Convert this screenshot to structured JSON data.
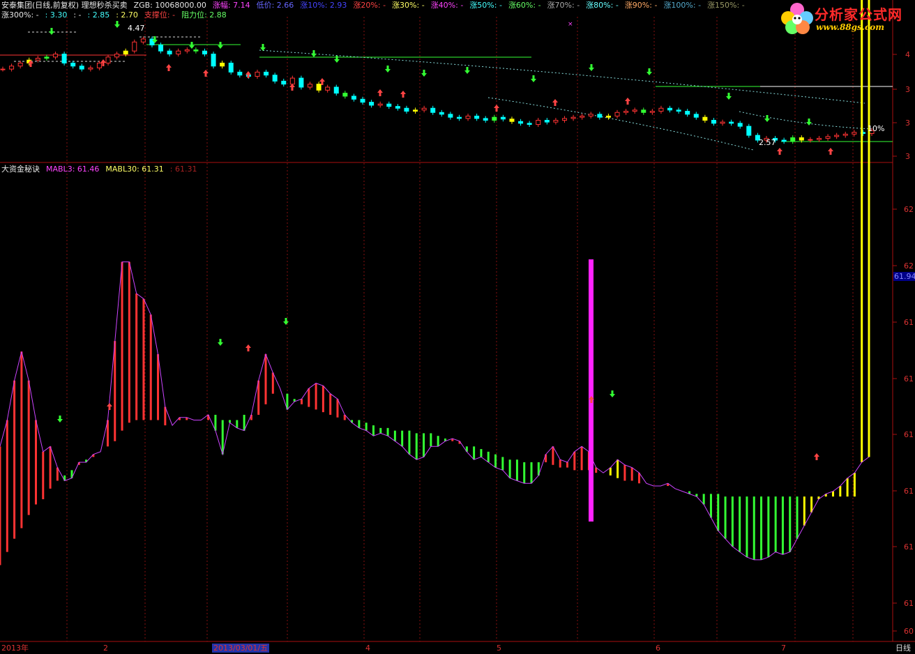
{
  "header": {
    "row1": [
      {
        "text": "安泰集团(日线,前复权) 理想秒杀买卖",
        "color": "#e8e8e8"
      },
      {
        "text": "ZGB: 10068000.00",
        "color": "#e8e8e8"
      },
      {
        "text": "涨幅: 7.14",
        "color": "#ff44ff"
      },
      {
        "text": "低价: 2.66",
        "color": "#6666ff"
      },
      {
        "text": "涨10%: 2.93",
        "color": "#4444ff"
      },
      {
        "text": "涨20%: -",
        "color": "#ff4444"
      },
      {
        "text": "涨30%: -",
        "color": "#ffff66"
      },
      {
        "text": "涨40%: -",
        "color": "#ff44ff"
      },
      {
        "text": "涨50%: -",
        "color": "#44ffff"
      },
      {
        "text": "涨60%: -",
        "color": "#66ff66"
      },
      {
        "text": "涨70%: -",
        "color": "#aaaaaa"
      },
      {
        "text": "涨80%: -",
        "color": "#66ffff"
      },
      {
        "text": "涨90%: -",
        "color": "#ffaa66"
      },
      {
        "text": "涨100%: -",
        "color": "#55aacc"
      },
      {
        "text": "涨150%: -",
        "color": "#999966"
      }
    ],
    "row2": [
      {
        "text": "涨300%: -",
        "color": "#e8e8e8"
      },
      {
        "text": ": 3.30",
        "color": "#44ffff"
      },
      {
        "text": ": -",
        "color": "#e8e8e8"
      },
      {
        "text": ": 2.85",
        "color": "#44ffff"
      },
      {
        "text": ": 2.70",
        "color": "#ffff66"
      },
      {
        "text": "支撑位: -",
        "color": "#ff4444"
      },
      {
        "text": "阻力位: 2.88",
        "color": "#66ff66"
      }
    ],
    "lower_title": [
      {
        "text": "大资金秘诀",
        "color": "#e8e8e8"
      },
      {
        "text": "MABL3: 61.46",
        "color": "#ff44ff"
      },
      {
        "text": "MABL30: 61.31",
        "color": "#ffff66"
      },
      {
        "text": ": 61.31",
        "color": "#aa2222"
      }
    ]
  },
  "logo": {
    "title": "分析家公式网",
    "url": "www.88gs.com"
  },
  "annotations": {
    "high_label": "4.47",
    "low_label": "2.57",
    "pct_label": "10%",
    "price_tag": "61.94"
  },
  "axes": {
    "upper_right_ticks": [
      "4",
      "3",
      "3",
      "3"
    ],
    "lower_right_ticks": [
      "62",
      "62",
      "61",
      "61",
      "61",
      "61",
      "61",
      "61",
      "60"
    ],
    "x_labels": [
      "2013年",
      "2",
      "2013/03/01/五",
      "4",
      "5",
      "6",
      "7"
    ],
    "period": "日线"
  },
  "colors": {
    "up": "#ff3333",
    "down": "#00ffff",
    "flat_yellow": "#ffff00",
    "green": "#33ff33",
    "magenta": "#ff22ff",
    "grid": "#881111"
  },
  "chart_data": [
    {
      "type": "candlestick",
      "title": "安泰集团(日线,前复权) 理想秒杀买卖",
      "y_range": [
        2.4,
        4.6
      ],
      "note_values": {
        "high": 4.47,
        "low": 2.57
      },
      "close": [
        3.8,
        3.85,
        3.9,
        3.95,
        3.98,
        4.0,
        4.05,
        3.9,
        3.85,
        3.8,
        3.82,
        3.9,
        4.0,
        4.05,
        4.1,
        4.25,
        4.3,
        4.2,
        4.1,
        4.05,
        4.1,
        4.12,
        4.1,
        4.05,
        3.85,
        3.9,
        3.75,
        3.7,
        3.68,
        3.75,
        3.7,
        3.6,
        3.55,
        3.65,
        3.5,
        3.55,
        3.45,
        3.5,
        3.4,
        3.35,
        3.3,
        3.25,
        3.2,
        3.22,
        3.18,
        3.15,
        3.1,
        3.12,
        3.15,
        3.08,
        3.05,
        3.0,
        2.98,
        3.02,
        2.98,
        2.95,
        3.0,
        2.97,
        2.93,
        2.9,
        2.88,
        2.95,
        2.92,
        2.95,
        2.98,
        3.0,
        3.02,
        3.05,
        3.0,
        3.02,
        3.08,
        3.1,
        3.12,
        3.08,
        3.1,
        3.15,
        3.12,
        3.1,
        3.05,
        3.0,
        2.95,
        2.9,
        2.92,
        2.9,
        2.85,
        2.7,
        2.62,
        2.65,
        2.62,
        2.6,
        2.66,
        2.62,
        2.63,
        2.65,
        2.68,
        2.7,
        2.72,
        2.75,
        2.73,
        2.78
      ]
    },
    {
      "type": "bar",
      "title": "大资金秘诀",
      "series": [
        {
          "name": "MABL3",
          "values": [
            61.46
          ]
        },
        {
          "name": "MABL30",
          "values": [
            61.31
          ]
        }
      ],
      "y_range": [
        60.8,
        62.4
      ],
      "tick_labels": [
        "62",
        "62",
        "61",
        "61",
        "61",
        "61",
        "61",
        "61",
        "60"
      ],
      "mabl3": [
        61.5,
        61.6,
        61.75,
        61.86,
        61.75,
        61.6,
        61.48,
        61.5,
        61.42,
        61.37,
        61.38,
        61.44,
        61.44,
        61.47,
        61.48,
        61.6,
        61.9,
        62.2,
        62.2,
        62.08,
        62.06,
        62.0,
        61.85,
        61.65,
        61.58,
        61.61,
        61.61,
        61.6,
        61.6,
        61.62,
        61.56,
        61.47,
        61.59,
        61.57,
        61.56,
        61.62,
        61.75,
        61.85,
        61.78,
        61.72,
        61.64,
        61.67,
        61.68,
        61.72,
        61.74,
        61.73,
        61.7,
        61.68,
        61.62,
        61.59,
        61.57,
        61.56,
        61.54,
        61.55,
        61.54,
        61.52,
        61.5,
        61.47,
        61.45,
        61.46,
        61.5,
        61.5,
        61.52,
        61.53,
        61.52,
        61.48,
        61.45,
        61.46,
        61.44,
        61.42,
        61.41,
        61.38,
        61.37,
        61.36,
        61.36,
        61.39,
        61.47,
        61.5,
        61.45,
        61.44,
        61.48,
        61.5,
        61.48,
        61.42,
        61.4,
        61.42,
        61.45,
        61.43,
        61.42,
        61.4,
        61.36,
        61.35,
        61.35,
        61.36,
        61.34,
        61.33,
        61.32,
        61.31,
        61.28,
        61.23,
        61.18,
        61.15,
        61.12,
        61.1,
        61.08,
        61.07,
        61.07,
        61.08,
        61.1,
        61.09,
        61.1,
        61.15,
        61.2,
        61.25,
        61.3,
        61.32,
        61.33,
        61.35,
        61.38,
        61.4,
        61.44,
        61.46
      ],
      "mabl30": [
        61.05,
        61.1,
        61.15,
        61.19,
        61.24,
        61.28,
        61.3,
        61.34,
        61.37,
        61.39,
        61.41,
        61.43,
        61.45,
        61.46,
        61.48,
        61.5,
        61.52,
        61.56,
        61.59,
        61.6,
        61.6,
        61.6,
        61.6,
        61.58,
        61.58,
        61.6,
        61.6,
        61.6,
        61.6,
        61.6,
        61.62,
        61.6,
        61.6,
        61.6,
        61.62,
        61.6,
        61.62,
        61.66,
        61.7,
        61.72,
        61.7,
        61.68,
        61.66,
        61.65,
        61.64,
        61.63,
        61.62,
        61.61,
        61.6,
        61.6,
        61.6,
        61.59,
        61.58,
        61.57,
        61.57,
        61.56,
        61.56,
        61.56,
        61.55,
        61.55,
        61.55,
        61.54,
        61.53,
        61.52,
        61.51,
        61.5,
        61.5,
        61.49,
        61.48,
        61.47,
        61.46,
        61.45,
        61.45,
        61.44,
        61.44,
        61.44,
        61.44,
        61.43,
        61.42,
        61.42,
        61.41,
        61.41,
        61.41,
        61.4,
        61.4,
        61.39,
        61.38,
        61.37,
        61.37,
        61.36,
        61.36,
        61.35,
        61.35,
        61.35,
        61.34,
        61.33,
        61.33,
        61.32,
        61.32,
        61.32,
        61.32,
        61.31,
        61.31,
        61.31,
        61.31,
        61.31,
        61.31,
        61.31,
        61.31,
        61.31,
        61.31,
        61.31,
        61.31,
        61.31,
        61.31,
        61.31,
        61.31,
        61.31,
        61.31,
        61.31
      ]
    }
  ]
}
